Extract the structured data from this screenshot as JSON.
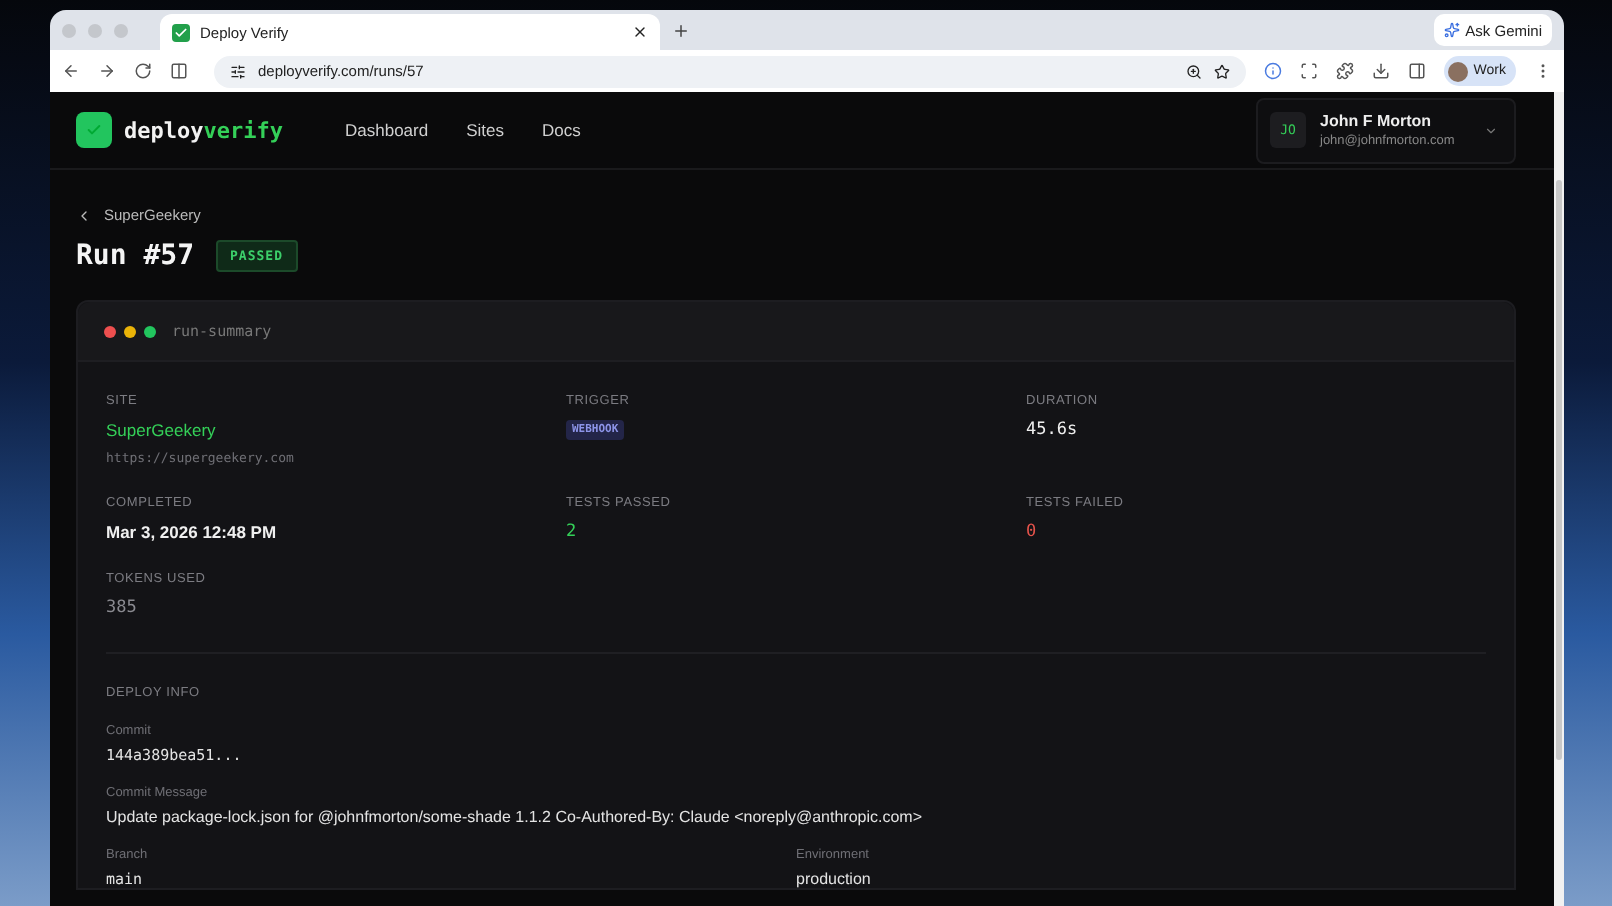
{
  "browser": {
    "tab_title": "Deploy Verify",
    "url": "deployverify.com/runs/57",
    "gemini_button": "Ask Gemini",
    "profile": "Work"
  },
  "header": {
    "logo": {
      "prefix": "deploy",
      "suffix": "verify"
    },
    "nav": [
      "Dashboard",
      "Sites",
      "Docs"
    ],
    "user": {
      "initials": "JO",
      "name": "John F Morton",
      "email": "john@johnfmorton.com"
    }
  },
  "breadcrumb": "SuperGeekery",
  "run": {
    "title": "Run #57",
    "status": "PASSED"
  },
  "card": {
    "title": "run-summary",
    "stats": [
      {
        "label": "SITE",
        "value": "SuperGeekery",
        "kind": "link",
        "sub": "https://supergeekery.com"
      },
      {
        "label": "TRIGGER",
        "value": "WEBHOOK",
        "kind": "badge"
      },
      {
        "label": "DURATION",
        "value": "45.6s",
        "kind": "mono"
      },
      {
        "label": "COMPLETED",
        "value": "Mar 3, 2026 12:48 PM",
        "kind": "text"
      },
      {
        "label": "TESTS PASSED",
        "value": "2",
        "kind": "pass"
      },
      {
        "label": "TESTS FAILED",
        "value": "0",
        "kind": "fail"
      },
      {
        "label": "TOKENS USED",
        "value": "385",
        "kind": "muted"
      }
    ],
    "deploy_info": {
      "title": "DEPLOY INFO",
      "fields": [
        {
          "label": "Commit",
          "value": "144a389bea51...",
          "kind": "mono"
        },
        {
          "label": "Commit Message",
          "value": "Update package-lock.json for @johnfmorton/some-shade 1.1.2 Co-Authored-By: Claude <noreply@anthropic.com>",
          "kind": "wide"
        },
        {
          "label": "Branch",
          "value": "main",
          "kind": "mono"
        },
        {
          "label": "Environment",
          "value": "production",
          "kind": "text"
        }
      ]
    }
  }
}
